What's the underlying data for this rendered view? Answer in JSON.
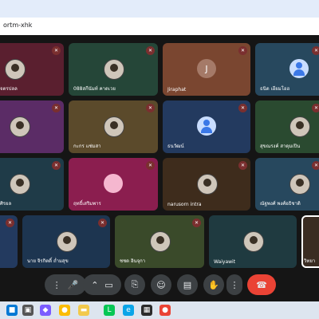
{
  "browser": {
    "url": "ortm-xhk"
  },
  "participants": [
    {
      "name": "จตรปลล",
      "bg": "#5a1f2f",
      "avatar": "photo",
      "muted": true
    },
    {
      "name": "088สกีนัมท์ คาดเวย",
      "bg": "#254638",
      "avatar": "photo",
      "muted": true
    },
    {
      "name": "Jiraphat",
      "bg": "#7a4630",
      "avatar": "J",
      "avatar_bg": "#a57a68",
      "muted": true
    },
    {
      "name": "ธนิด เอียมโอฮ",
      "bg": "#27485e",
      "avatar": "silhouette",
      "muted": true
    },
    {
      "name": "",
      "bg": "#5b2c66",
      "avatar": "photo",
      "muted": true
    },
    {
      "name": "กะกร แช่มสา",
      "bg": "#5b4a2b",
      "avatar": "photo",
      "muted": true
    },
    {
      "name": "ธนวัฒน์",
      "bg": "#233a5f",
      "avatar": "silhouette",
      "muted": true
    },
    {
      "name": "สุขณรงค์ สาดุมเปิน",
      "bg": "#2a4a30",
      "avatar": "photo",
      "muted": true
    },
    {
      "name": "ศิรยล",
      "bg": "#1f3b48",
      "avatar": "photo",
      "muted": true
    },
    {
      "name": "ฤทธิ์เสริมพาร",
      "bg": "#8b1e4f",
      "avatar": "silhouette-pink",
      "muted": true
    },
    {
      "name": "narusorn intra",
      "bg": "#3e2c1c",
      "avatar": "photo",
      "muted": true
    },
    {
      "name": "ณัฐพงศ์ พงศ์อธิชาติ",
      "bg": "#27485e",
      "avatar": "photo",
      "muted": true
    },
    {
      "name": "",
      "bg": "#233a5f",
      "avatar": "",
      "muted": true
    },
    {
      "name": "นาย จิรกิตติ์ ถ่ำมสุข",
      "bg": "#1d3550",
      "avatar": "photo",
      "muted": true
    },
    {
      "name": "ชชด อินจุกา",
      "bg": "#3a4a2a",
      "avatar": "photo",
      "muted": true
    },
    {
      "name": "Waiyawit",
      "bg": "#1f3a40",
      "avatar": "photo",
      "muted": false
    },
    {
      "name": "วิทยา",
      "bg": "#3a2c22",
      "avatar": "photo-live",
      "muted": false,
      "selected": true
    }
  ],
  "controls": {
    "buttons": [
      "sound-bars",
      "mic",
      "more-up",
      "camera",
      "present",
      "emoji",
      "captions",
      "raise-hand",
      "more",
      "leave-call"
    ]
  },
  "taskbar": {
    "items": [
      "start",
      "search",
      "widgets",
      "copilot",
      "chrome",
      "file-explorer",
      "line",
      "edge",
      "store",
      "chrome-active"
    ]
  }
}
